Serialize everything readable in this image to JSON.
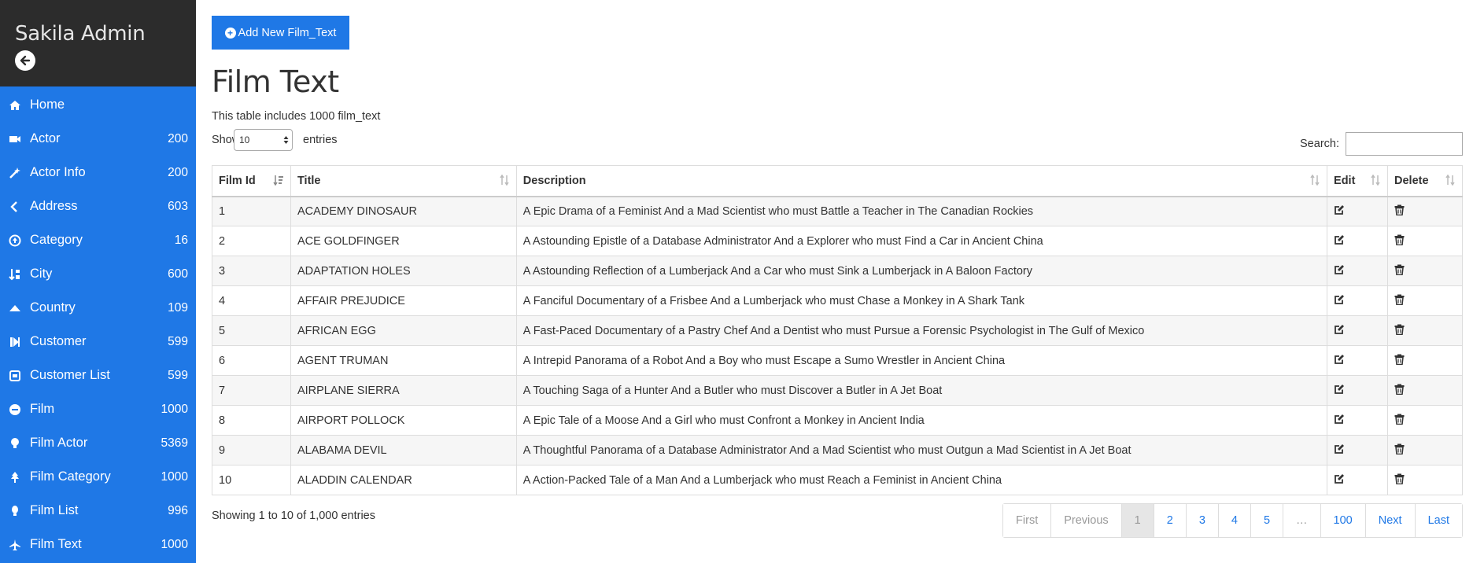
{
  "sidebar": {
    "brand": "Sakila Admin",
    "items": [
      {
        "label": "Home",
        "count": "",
        "icon": "home-icon"
      },
      {
        "label": "Actor",
        "count": "200",
        "icon": "video-camera-icon"
      },
      {
        "label": "Actor Info",
        "count": "200",
        "icon": "magic-wand-icon"
      },
      {
        "label": "Address",
        "count": "603",
        "icon": "chevron-left-icon"
      },
      {
        "label": "Category",
        "count": "16",
        "icon": "circle-arrow-icon"
      },
      {
        "label": "City",
        "count": "600",
        "icon": "sort-numeric-icon"
      },
      {
        "label": "Country",
        "count": "109",
        "icon": "caret-up-icon"
      },
      {
        "label": "Customer",
        "count": "599",
        "icon": "step-forward-icon"
      },
      {
        "label": "Customer List",
        "count": "599",
        "icon": "square-icon"
      },
      {
        "label": "Film",
        "count": "1000",
        "icon": "minus-circle-icon"
      },
      {
        "label": "Film Actor",
        "count": "5369",
        "icon": "lightbulb-icon"
      },
      {
        "label": "Film Category",
        "count": "1000",
        "icon": "tree-icon"
      },
      {
        "label": "Film List",
        "count": "996",
        "icon": "bulb-icon"
      },
      {
        "label": "Film Text",
        "count": "1000",
        "icon": "plane-icon"
      }
    ]
  },
  "main": {
    "add_button": "Add New Film_Text",
    "title": "Film Text",
    "subtitle": "This table includes 1000 film_text",
    "show_label": "Show",
    "show_value": "10",
    "entries_label": "entries",
    "search_label": "Search:",
    "search_value": "",
    "columns": [
      "Film Id",
      "Title",
      "Description",
      "Edit",
      "Delete"
    ],
    "rows": [
      {
        "id": "1",
        "title": "ACADEMY DINOSAUR",
        "description": "A Epic Drama of a Feminist And a Mad Scientist who must Battle a Teacher in The Canadian Rockies"
      },
      {
        "id": "2",
        "title": "ACE GOLDFINGER",
        "description": "A Astounding Epistle of a Database Administrator And a Explorer who must Find a Car in Ancient China"
      },
      {
        "id": "3",
        "title": "ADAPTATION HOLES",
        "description": "A Astounding Reflection of a Lumberjack And a Car who must Sink a Lumberjack in A Baloon Factory"
      },
      {
        "id": "4",
        "title": "AFFAIR PREJUDICE",
        "description": "A Fanciful Documentary of a Frisbee And a Lumberjack who must Chase a Monkey in A Shark Tank"
      },
      {
        "id": "5",
        "title": "AFRICAN EGG",
        "description": "A Fast-Paced Documentary of a Pastry Chef And a Dentist who must Pursue a Forensic Psychologist in The Gulf of Mexico"
      },
      {
        "id": "6",
        "title": "AGENT TRUMAN",
        "description": "A Intrepid Panorama of a Robot And a Boy who must Escape a Sumo Wrestler in Ancient China"
      },
      {
        "id": "7",
        "title": "AIRPLANE SIERRA",
        "description": "A Touching Saga of a Hunter And a Butler who must Discover a Butler in A Jet Boat"
      },
      {
        "id": "8",
        "title": "AIRPORT POLLOCK",
        "description": "A Epic Tale of a Moose And a Girl who must Confront a Monkey in Ancient India"
      },
      {
        "id": "9",
        "title": "ALABAMA DEVIL",
        "description": "A Thoughtful Panorama of a Database Administrator And a Mad Scientist who must Outgun a Mad Scientist in A Jet Boat"
      },
      {
        "id": "10",
        "title": "ALADDIN CALENDAR",
        "description": "A Action-Packed Tale of a Man And a Lumberjack who must Reach a Feminist in Ancient China"
      }
    ],
    "info": "Showing 1 to 10 of 1,000 entries",
    "pagination": [
      "First",
      "Previous",
      "1",
      "2",
      "3",
      "4",
      "5",
      "…",
      "100",
      "Next",
      "Last"
    ]
  },
  "colors": {
    "accent": "#1f78e6",
    "sidebar_head": "#2c2c2c"
  }
}
